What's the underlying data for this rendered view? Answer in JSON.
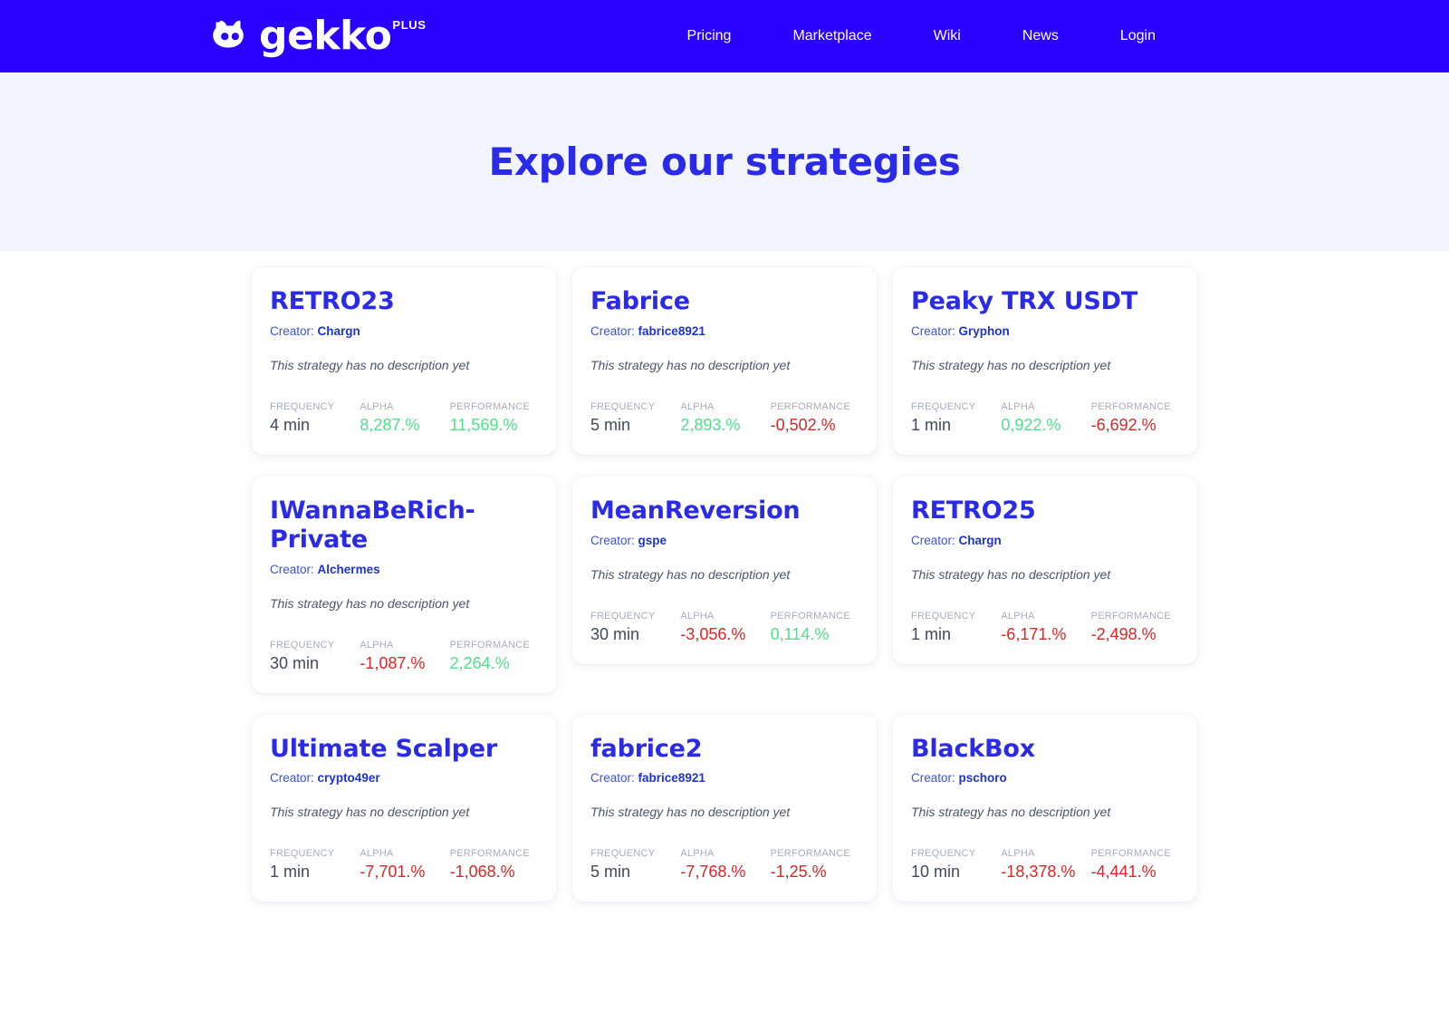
{
  "header": {
    "logo_icon": "gekko-mascot-icon",
    "brand_name": "gekko",
    "brand_superscript": "PLUS",
    "nav": [
      {
        "label": "Pricing"
      },
      {
        "label": "Marketplace"
      },
      {
        "label": "Wiki"
      },
      {
        "label": "News"
      },
      {
        "label": "Login"
      }
    ]
  },
  "hero": {
    "title": "Explore our strategies"
  },
  "stat_labels": {
    "frequency": "FREQUENCY",
    "alpha": "ALPHA",
    "performance": "PERFORMANCE"
  },
  "creator_prefix": "Creator:",
  "colors": {
    "brand_blue": "#2a00ff",
    "title_blue": "#2a2ae8",
    "hero_background": "#f2f4fe",
    "positive_green": "#4fe08a",
    "negative_red": "#e02424",
    "label_gray": "#a6adbb"
  },
  "cards": [
    {
      "title": "RETRO23",
      "creator": "Chargn",
      "description": "This strategy has no description yet",
      "frequency": "4 min",
      "alpha": "8,287.%",
      "alpha_sign": "pos",
      "performance": "11,569.%",
      "performance_sign": "pos"
    },
    {
      "title": "Fabrice",
      "creator": "fabrice8921",
      "description": "This strategy has no description yet",
      "frequency": "5 min",
      "alpha": "2,893.%",
      "alpha_sign": "pos",
      "performance": "-0,502.%",
      "performance_sign": "neg"
    },
    {
      "title": "Peaky TRX USDT",
      "creator": "Gryphon",
      "description": "This strategy has no description yet",
      "frequency": "1 min",
      "alpha": "0,922.%",
      "alpha_sign": "pos",
      "performance": "-6,692.%",
      "performance_sign": "neg"
    },
    {
      "title": "IWannaBeRich-Private",
      "creator": "Alchermes",
      "description": "This strategy has no description yet",
      "frequency": "30 min",
      "alpha": "-1,087.%",
      "alpha_sign": "neg",
      "performance": "2,264.%",
      "performance_sign": "pos"
    },
    {
      "title": "MeanReversion",
      "creator": "gspe",
      "description": "This strategy has no description yet",
      "frequency": "30 min",
      "alpha": "-3,056.%",
      "alpha_sign": "neg",
      "performance": "0,114.%",
      "performance_sign": "pos"
    },
    {
      "title": "RETRO25",
      "creator": "Chargn",
      "description": "This strategy has no description yet",
      "frequency": "1 min",
      "alpha": "-6,171.%",
      "alpha_sign": "neg",
      "performance": "-2,498.%",
      "performance_sign": "neg"
    },
    {
      "title": "Ultimate Scalper",
      "creator": "crypto49er",
      "description": "This strategy has no description yet",
      "frequency": "1 min",
      "alpha": "-7,701.%",
      "alpha_sign": "neg",
      "performance": "-1,068.%",
      "performance_sign": "neg"
    },
    {
      "title": "fabrice2",
      "creator": "fabrice8921",
      "description": "This strategy has no description yet",
      "frequency": "5 min",
      "alpha": "-7,768.%",
      "alpha_sign": "neg",
      "performance": "-1,25.%",
      "performance_sign": "neg"
    },
    {
      "title": "BlackBox",
      "creator": "pschoro",
      "description": "This strategy has no description yet",
      "frequency": "10 min",
      "alpha": "-18,378.%",
      "alpha_sign": "neg",
      "performance": "-4,441.%",
      "performance_sign": "neg"
    }
  ]
}
